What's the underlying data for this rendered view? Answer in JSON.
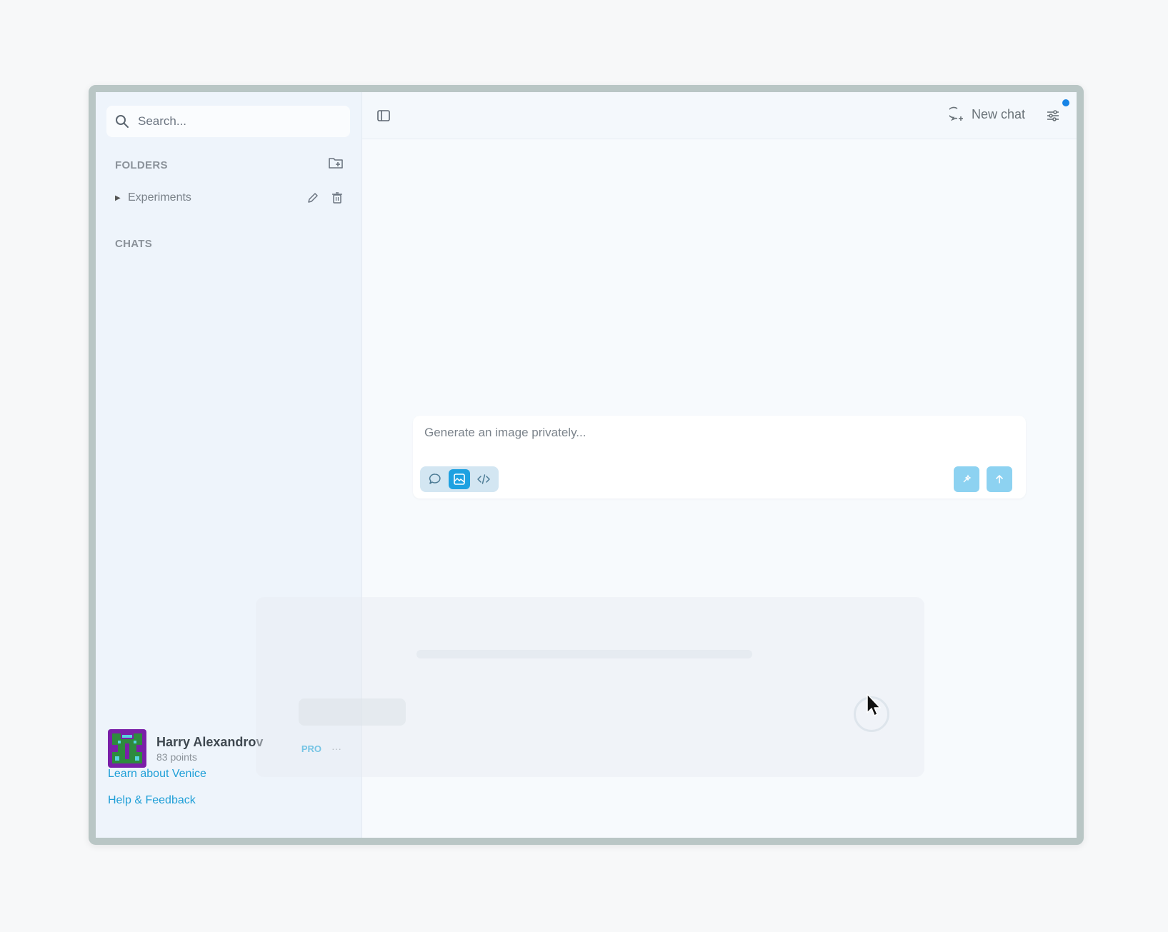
{
  "sidebar": {
    "search_placeholder": "Search...",
    "folders_label": "FOLDERS",
    "folders": [
      {
        "name": "Experiments"
      }
    ],
    "chats_label": "CHATS",
    "user": {
      "name": "Harry Alexandrov",
      "points": "83 points",
      "badge": "PRO",
      "more": "···"
    },
    "links": {
      "learn": "Learn about Venice",
      "help": "Help & Feedback"
    }
  },
  "header": {
    "new_chat_label": "New chat"
  },
  "composer": {
    "placeholder": "Generate an image privately...",
    "modes": [
      "chat",
      "image",
      "code"
    ],
    "active_mode": "image"
  },
  "colors": {
    "accent": "#1da1e1",
    "link": "#1f9fd7",
    "notification": "#1784e6",
    "pro_badge": "#1aa5d9"
  },
  "icons": {
    "search": "search-icon",
    "new_folder": "folder-plus-icon",
    "edit": "pencil-icon",
    "delete": "trash-icon",
    "sidebar_toggle": "panel-toggle-icon",
    "new_chat": "chat-plus-icon",
    "settings": "sliders-icon",
    "chat_mode": "speech-bubble-icon",
    "image_mode": "image-icon",
    "code_mode": "code-icon",
    "enhance": "sparkle-icon",
    "send": "arrow-up-icon"
  }
}
